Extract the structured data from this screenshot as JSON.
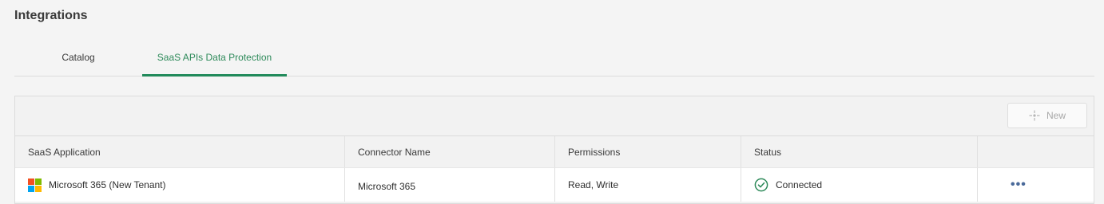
{
  "page": {
    "title": "Integrations"
  },
  "tabs": [
    {
      "label": "Catalog",
      "active": false
    },
    {
      "label": "SaaS APIs Data Protection",
      "active": true
    }
  ],
  "toolbar": {
    "new_label": "New",
    "new_icon": "sparkle-plus-icon"
  },
  "table": {
    "columns": [
      "SaaS Application",
      "Connector Name",
      "Permissions",
      "Status",
      ""
    ],
    "rows": [
      {
        "app_icon": "microsoft-logo-icon",
        "application": "Microsoft 365 (New Tenant)",
        "connector": "Microsoft 365",
        "permissions": "Read, Write",
        "status_icon": "check-circle-icon",
        "status": "Connected",
        "actions_icon": "more-horizontal-icon"
      }
    ]
  },
  "colors": {
    "accent": "#218a5a",
    "status_ok": "#2e8a5a",
    "ms_red": "#f25022",
    "ms_green": "#7fba00",
    "ms_blue": "#00a4ef",
    "ms_yellow": "#ffb900"
  }
}
